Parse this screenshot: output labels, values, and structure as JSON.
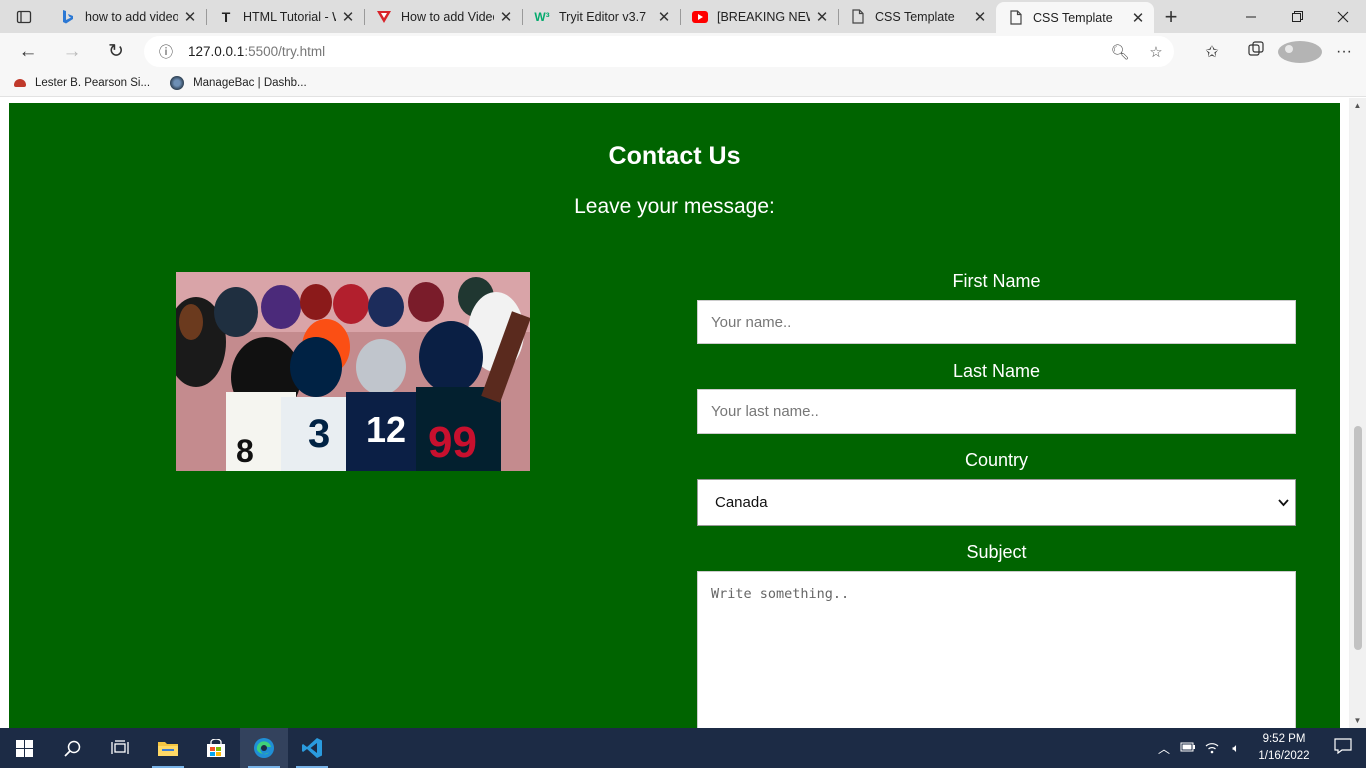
{
  "browser": {
    "tabs": [
      {
        "title": "how to add video",
        "icon": "bing-icon",
        "color": "#2b78d4"
      },
      {
        "title": "HTML Tutorial - W",
        "icon": "t-icon",
        "color": "#222222"
      },
      {
        "title": "How to add Video",
        "icon": "v-icon",
        "color": "#d8232a"
      },
      {
        "title": "Tryit Editor v3.7",
        "icon": "w3-icon",
        "color": "#04aa6d"
      },
      {
        "title": "[BREAKING NEWS]",
        "icon": "youtube-icon",
        "color": "#ff0000"
      },
      {
        "title": "CSS Template",
        "icon": "page-icon",
        "color": "#444444"
      },
      {
        "title": "CSS Template",
        "icon": "page-icon",
        "color": "#444444"
      }
    ],
    "address": {
      "host": "127.0.0.1",
      "rest": ":5500/try.html"
    },
    "bookmarks": [
      {
        "label": "Lester B. Pearson Si...",
        "color": "#c0392b"
      },
      {
        "label": "ManageBac | Dashb...",
        "color": "#2c3e50"
      }
    ]
  },
  "page": {
    "title": "Contact Us",
    "subtitle": "Leave your message:",
    "form": {
      "first_name_label": "First Name",
      "first_name_placeholder": "Your name..",
      "last_name_label": "Last Name",
      "last_name_placeholder": "Your last name..",
      "country_label": "Country",
      "country_value": "Canada",
      "subject_label": "Subject",
      "subject_placeholder": "Write something.."
    },
    "background_color": "#006400"
  },
  "taskbar": {
    "time": "9:52 PM",
    "date": "1/16/2022"
  }
}
